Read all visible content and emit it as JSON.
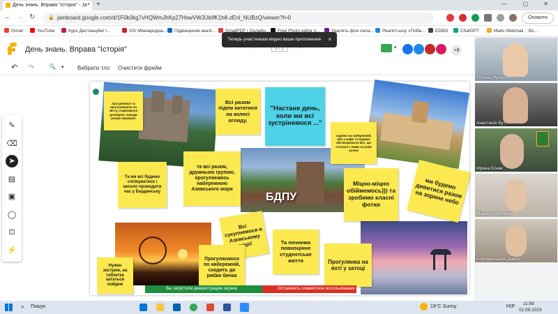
{
  "browser": {
    "tab_title": "День знань. Вправа \"Історія\" - Ja",
    "tab_close": "×",
    "new_tab": "+",
    "url": "jamboard.google.com/d/1F0k0kg7vHQWmJhKp27HswVWJUbIfK1h8-zEnl_NUBzQ/viewer?f=0",
    "update_button": "Оновити",
    "window_controls": "— ▢ ✕"
  },
  "bookmarks": [
    {
      "label": "Gmail",
      "color": "#ea4335"
    },
    {
      "label": "YouTube",
      "color": "#ff0000"
    },
    {
      "label": "Курс Дистанційні т...",
      "color": "#c2185b"
    },
    {
      "label": "XIV Міжнародна...",
      "color": "#c62828"
    },
    {
      "label": "Підвищення квалі...",
      "color": "#1565c0"
    },
    {
      "label": "SmallPDF | Онлайн...",
      "color": "#e53935"
    },
    {
      "label": "Free Photo editor o...",
      "color": "#111111"
    },
    {
      "label": "Удалить фон онла...",
      "color": "#6a1b9a"
    },
    {
      "label": "Реаліті-шоу «Поба...",
      "color": "#1e88e5"
    },
    {
      "label": "EDBO",
      "color": "#37474f"
    },
    {
      "label": "ChatGPT",
      "color": "#10a37f"
    },
    {
      "label": "Mailu Webmail :: Вх...",
      "color": "#f9a825"
    }
  ],
  "jamboard": {
    "title": "День знань. Вправа \"Історія\"",
    "toast": "Теперь участникам видно ваше приложение",
    "toast_close": "×",
    "pager": "1 / 1",
    "avatar_count": "+8",
    "toolbar": {
      "undo": "↶",
      "redo": "↷",
      "zoom": "🔍",
      "background_button": "Вибрати тло",
      "clear_button": "Очистити фрейм"
    }
  },
  "notes": [
    {
      "text": "Зустрінемся та прогуляємося по місту, поділимося досвідом, поради разом пережил!",
      "color": "#fce94f"
    },
    {
      "text": "Всі разом підем кататися на колесі огляду.",
      "color": "#fce94f"
    },
    {
      "text": "\"Настане день, коли ми всі зустрінемося ...\"",
      "color": "#4dd2e7"
    },
    {
      "text": "сидемо на набережній, або у кафе та будемо обговорювати все, що сталося з нами за роки разом",
      "color": "#fce94f"
    },
    {
      "text": "Та ми всі будемо спілкуватися і весело проводити час у Бердянську",
      "color": "#fce94f"
    },
    {
      "text": "та всі разом, дружньою групою, прогуляємось набережною Азовського моря",
      "color": "#fce94f"
    },
    {
      "text": "Міцно-міцно обіймемось))) та зробимо класні фотки",
      "color": "#fce94f"
    },
    {
      "text": "ми будемо дивитися разом на зоряне небо",
      "color": "#fce94f"
    },
    {
      "text": "Всі сукупнемося в Азовському морі!",
      "color": "#fce94f"
    },
    {
      "text": "Та почнемо повноцінне студентське життя",
      "color": "#fce94f"
    },
    {
      "text": "Нужен экстрим, на таблетке кататься пойдем",
      "color": "#fce94f"
    },
    {
      "text": "Прогуляємося по набережній, сходить до рибки бичка",
      "color": "#fce94f"
    },
    {
      "text": "Прогулянка на яхті у затоці",
      "color": "#fce94f"
    }
  ],
  "photo_caption": "БДПУ",
  "demo": {
    "sharing": "Вы запустили демонстрацию экрана",
    "stop": "Остановить совместное использование"
  },
  "participants": [
    {
      "name": "Тетяна Мухна"
    },
    {
      "name": "Анастасія Бут"
    },
    {
      "name": "Ирина Юнак"
    },
    {
      "name": "Мария Скрипник"
    },
    {
      "name": "Боровенський Давид"
    }
  ],
  "taskbar": {
    "search": "Пошук",
    "weather": "19°C  Sunny",
    "lang": "УКР",
    "time": "11:58",
    "date": "01.09.2023"
  }
}
